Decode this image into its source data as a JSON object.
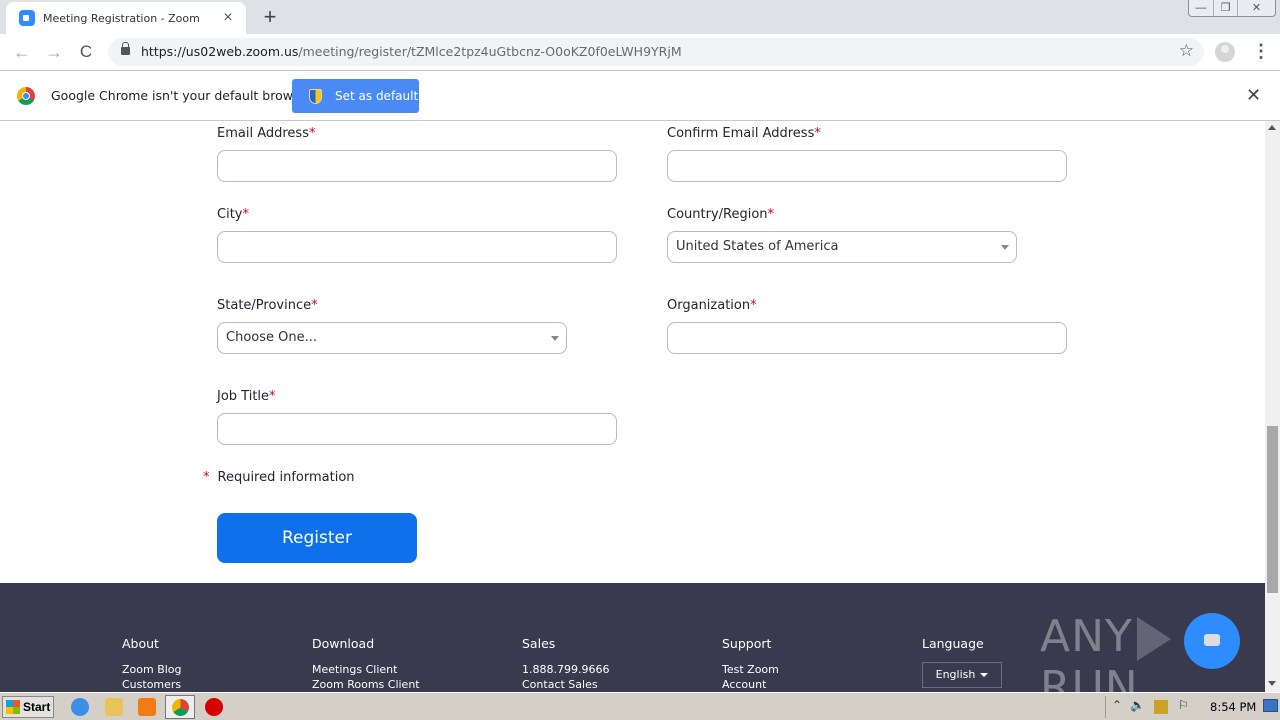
{
  "browser": {
    "tab": {
      "title": "Meeting Registration - Zoom",
      "close": "×"
    },
    "new_tab": "+",
    "window_controls": {
      "minimize": "—",
      "restore": "❐",
      "close": "✕"
    },
    "nav": {
      "back": "←",
      "forward": "→",
      "reload": "C"
    },
    "url": {
      "host": "https://us02web.zoom.us",
      "path": "/meeting/register/tZMlce2tpz4uGtbcnz-O0oKZ0f0eLWH9YRjM"
    },
    "bookmark_icon": "☆",
    "menu_icon": "⋮"
  },
  "infobar": {
    "message": "Google Chrome isn't your default browser",
    "button_label": "Set as default",
    "close": "✕"
  },
  "form": {
    "fields": [
      {
        "label": "Email Address",
        "required": "*",
        "value": "",
        "type": "text"
      },
      {
        "label": "Confirm Email Address",
        "required": "*",
        "value": "",
        "type": "text"
      },
      {
        "label": "City",
        "required": "*",
        "value": "",
        "type": "text"
      },
      {
        "label": "Country/Region",
        "required": "*",
        "value": "United States of America",
        "type": "select"
      },
      {
        "label": "State/Province",
        "required": "*",
        "value": "Choose One...",
        "type": "select"
      },
      {
        "label": "Organization",
        "required": "*",
        "value": "",
        "type": "text"
      },
      {
        "label": "Job Title",
        "required": "*",
        "value": "",
        "type": "text"
      }
    ],
    "required_note": {
      "marker": "*",
      "text": "Required information"
    },
    "register_label": "Register",
    "required_color": "#d0021b",
    "button_color": "#0e71eb"
  },
  "footer": {
    "columns": [
      {
        "heading": "About",
        "links": [
          "Zoom Blog",
          "Customers"
        ]
      },
      {
        "heading": "Download",
        "links": [
          "Meetings Client",
          "Zoom Rooms Client"
        ]
      },
      {
        "heading": "Sales",
        "links": [
          "1.888.799.9666",
          "Contact Sales"
        ]
      },
      {
        "heading": "Support",
        "links": [
          "Test Zoom",
          "Account"
        ]
      },
      {
        "heading": "Language",
        "select_value": "English"
      }
    ],
    "watermark": {
      "left": "ANY",
      "right": "RUN"
    },
    "background": "#393a4d"
  },
  "taskbar": {
    "start_label": "Start",
    "tray": {
      "expand": "⌃",
      "volume": "🔈",
      "flag": "⚐"
    },
    "clock": "8:54 PM"
  }
}
